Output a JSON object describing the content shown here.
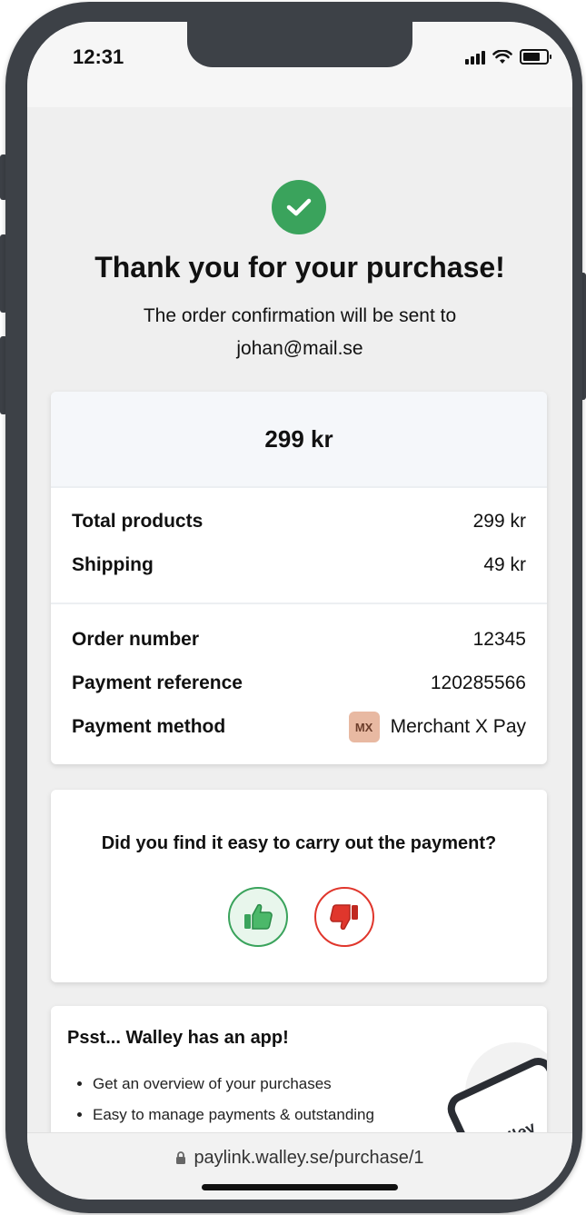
{
  "status_bar": {
    "time": "12:31"
  },
  "confirmation": {
    "title": "Thank you for your purchase!",
    "subtitle": "The order confirmation will be sent to johan@mail.se"
  },
  "summary": {
    "amount": "299 kr",
    "rows": [
      {
        "label": "Total products",
        "value": "299 kr"
      },
      {
        "label": "Shipping",
        "value": "49 kr"
      }
    ],
    "details": [
      {
        "label": "Order number",
        "value": "12345"
      },
      {
        "label": "Payment reference",
        "value": "120285566"
      }
    ],
    "payment_method": {
      "label": "Payment method",
      "logo_text": "MX",
      "value": "Merchant X Pay"
    }
  },
  "feedback": {
    "question": "Did you find it easy to carry out the payment?",
    "thumbs_up_icon": "thumbs-up-icon",
    "thumbs_down_icon": "thumbs-down-icon"
  },
  "app_promo": {
    "title": "Psst... Walley has an app!",
    "bullets": [
      "Get an overview of your purchases",
      "Easy to manage payments & outstanding"
    ],
    "phone_text": "walley"
  },
  "browser": {
    "url": "paylink.walley.se/purchase/1"
  },
  "colors": {
    "success": "#3aa35c",
    "danger": "#e0362c",
    "merchant_logo_bg": "#e8b9a2"
  }
}
